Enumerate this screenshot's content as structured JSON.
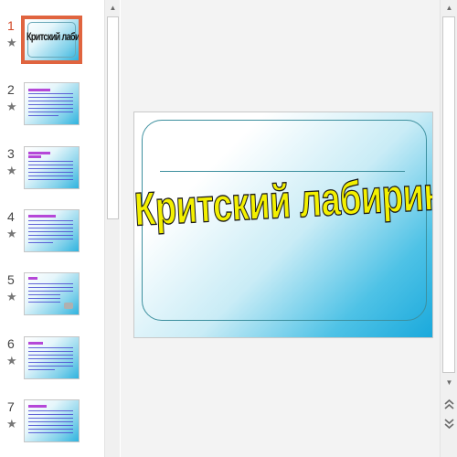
{
  "slides": [
    {
      "number": "1",
      "title": "Критский лабиринт.",
      "selected": true
    },
    {
      "number": "2",
      "selected": false
    },
    {
      "number": "3",
      "selected": false
    },
    {
      "number": "4",
      "selected": false
    },
    {
      "number": "5",
      "selected": false
    },
    {
      "number": "6",
      "selected": false
    },
    {
      "number": "7",
      "selected": false
    }
  ],
  "current_slide": {
    "title": "Критский лабиринт."
  },
  "icons": {
    "star": "★",
    "scroll_up": "▲",
    "scroll_down": "▼",
    "prev_slide": "⯭",
    "next_slide": "⯯"
  },
  "colors": {
    "selection_accent": "#e0643f",
    "title_fill": "#f3f000",
    "slide_gradient_end": "#1aa9dc"
  }
}
